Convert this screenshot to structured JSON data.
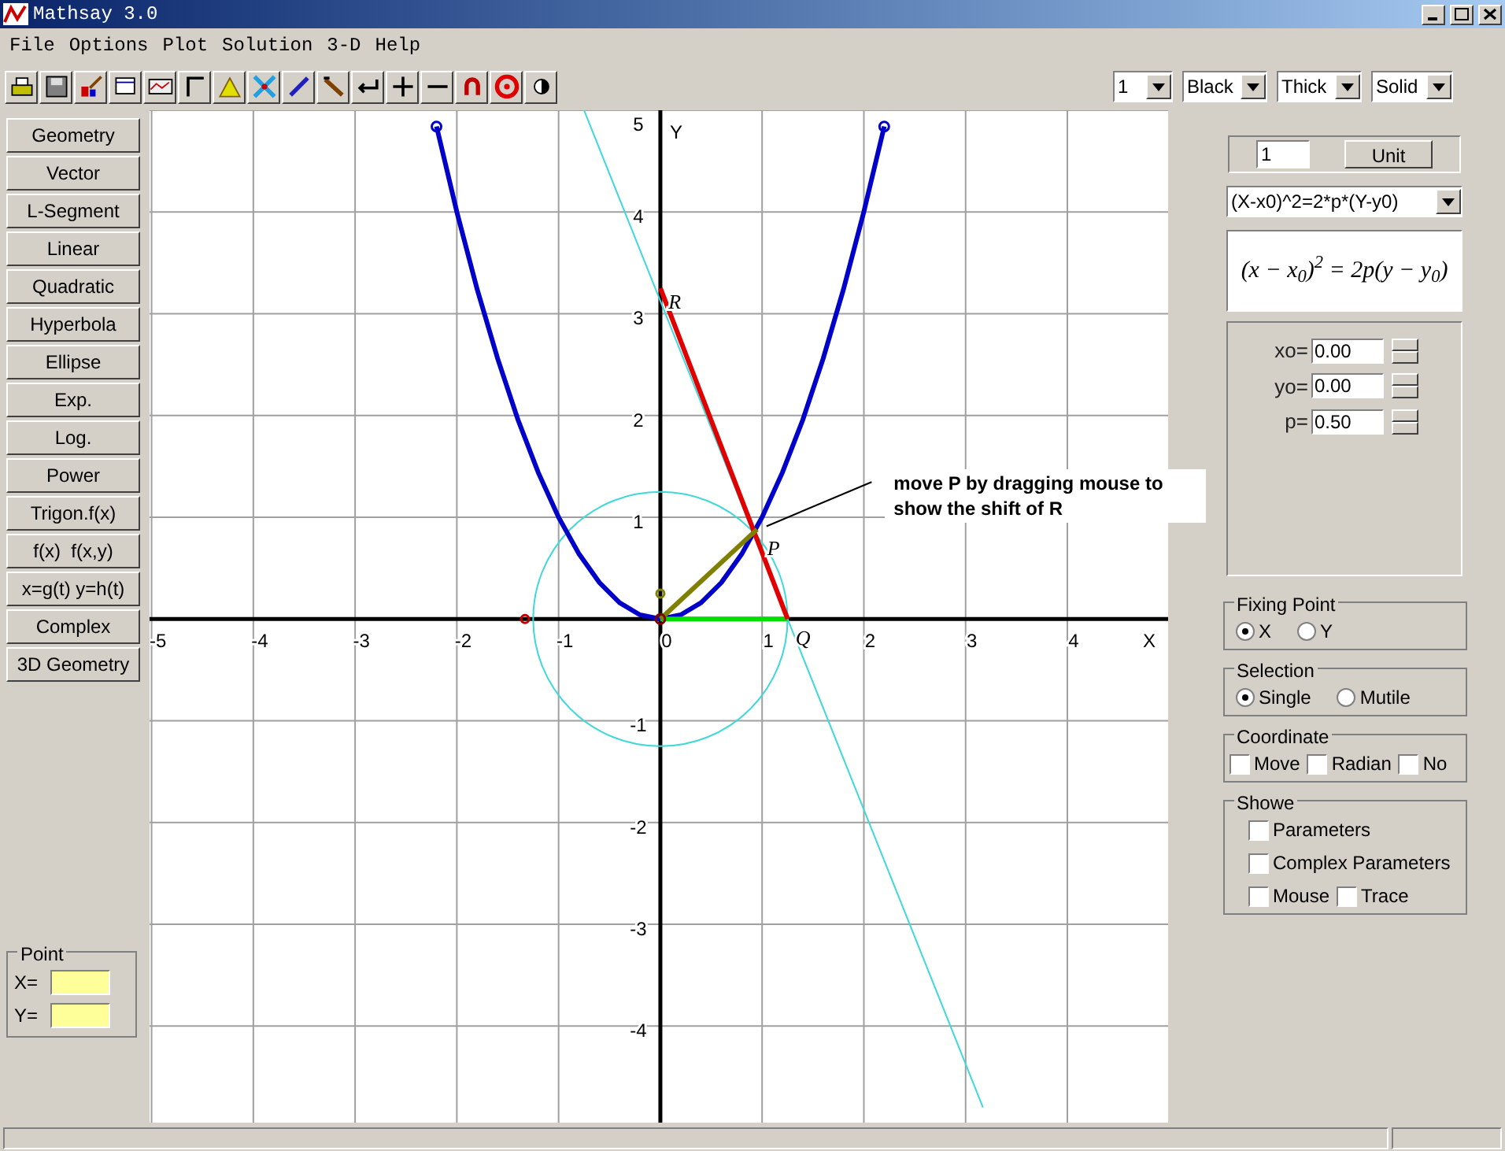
{
  "window": {
    "title": "Mathsay 3.0"
  },
  "menu": [
    "File",
    "Options",
    "Plot",
    "Solution",
    "3-D",
    "Help"
  ],
  "toolbar_selects": [
    {
      "value": "1"
    },
    {
      "value": "Black"
    },
    {
      "value": "Thick"
    },
    {
      "value": "Solid"
    }
  ],
  "sidebar": {
    "buttons": [
      "Geometry",
      "Vector",
      "L-Segment",
      "Linear",
      "Quadratic",
      "Hyperbola",
      "Ellipse",
      "Exp.",
      "Log.",
      "Power",
      "Trigon.f(x)",
      "f(x)  f(x,y)",
      "x=g(t) y=h(t)",
      "Complex",
      "3D Geometry"
    ],
    "point": {
      "title": "Point",
      "fields": [
        {
          "label": "X="
        },
        {
          "label": "Y="
        }
      ]
    }
  },
  "plot": {
    "chart_data": {
      "type": "line",
      "xlabel": "X",
      "ylabel": "Y",
      "xlim": [
        -5.02,
        4.99
      ],
      "ylim": [
        -4.95,
        5
      ],
      "grid": true,
      "xticks": [
        -5,
        -4,
        -3,
        -2,
        -1,
        0,
        1,
        2,
        3,
        4
      ],
      "yticks": [
        -4,
        -3,
        -2,
        -1,
        1,
        2,
        3,
        4,
        5
      ],
      "series": [
        {
          "color": "#40d8d8",
          "x": [
            -0.75,
            3.17
          ],
          "values": [
            5,
            -4.8
          ]
        },
        {
          "color": "#0000c8",
          "x": [
            -2.2,
            -2,
            -1.8,
            -1.6,
            -1.4,
            -1.2,
            -1,
            -0.8,
            -0.6,
            -0.4,
            -0.2,
            0,
            0.2,
            0.4,
            0.6,
            0.8,
            1,
            1.2,
            1.4,
            1.6,
            1.8,
            2,
            2.2
          ],
          "values": [
            4.84,
            4,
            3.24,
            2.56,
            1.96,
            1.44,
            1,
            0.64,
            0.36,
            0.16,
            0.04,
            0,
            0.04,
            0.16,
            0.36,
            0.64,
            1,
            1.44,
            1.96,
            2.56,
            3.24,
            4,
            4.84
          ]
        },
        {
          "color": "#00e000",
          "x": [
            0,
            1.25
          ],
          "values": [
            0,
            0
          ]
        },
        {
          "color": "#e00000",
          "x": [
            0,
            1.25
          ],
          "values": [
            3.25,
            0
          ]
        },
        {
          "color": "#808000",
          "x": [
            0,
            0.95
          ],
          "values": [
            0,
            0.88
          ]
        }
      ],
      "annotations": [
        "R",
        "P",
        "Q",
        "move P by dragging mouse to show the shift of R"
      ]
    }
  },
  "panel": {
    "unit": {
      "value": "1",
      "button": "Unit"
    },
    "equation_select": "(X-x0)^2=2*p*(Y-y0)",
    "formula": "(x − x$_{0}$)$^{2}$ = 2p(y − y$_{0}$)",
    "params": [
      {
        "label": "xo=",
        "value": "0.00"
      },
      {
        "label": "yo=",
        "value": "0.00"
      },
      {
        "label": "p=",
        "value": "0.50"
      }
    ],
    "groups": [
      {
        "title": "Fixing Point",
        "kind": "radio",
        "rows": [
          [
            {
              "label": "X",
              "selected": true
            },
            {
              "label": "Y",
              "selected": false
            }
          ]
        ]
      },
      {
        "title": "Selection",
        "kind": "radio",
        "rows": [
          [
            {
              "label": "Single",
              "selected": true
            },
            {
              "label": "Mutile",
              "selected": false
            }
          ]
        ]
      },
      {
        "title": "Coordinate",
        "kind": "checkbox",
        "rows": [
          [
            {
              "label": "Move",
              "checked": false
            },
            {
              "label": "Radian",
              "checked": false
            },
            {
              "label": "No",
              "checked": false
            }
          ]
        ]
      },
      {
        "title": "Showe",
        "kind": "checkbox",
        "rows": [
          [
            {
              "label": "Parameters",
              "checked": false
            }
          ],
          [
            {
              "label": "Complex Parameters",
              "checked": false
            }
          ],
          [
            {
              "label": "Mouse",
              "checked": false
            },
            {
              "label": "Trace",
              "checked": false
            }
          ]
        ]
      }
    ]
  }
}
